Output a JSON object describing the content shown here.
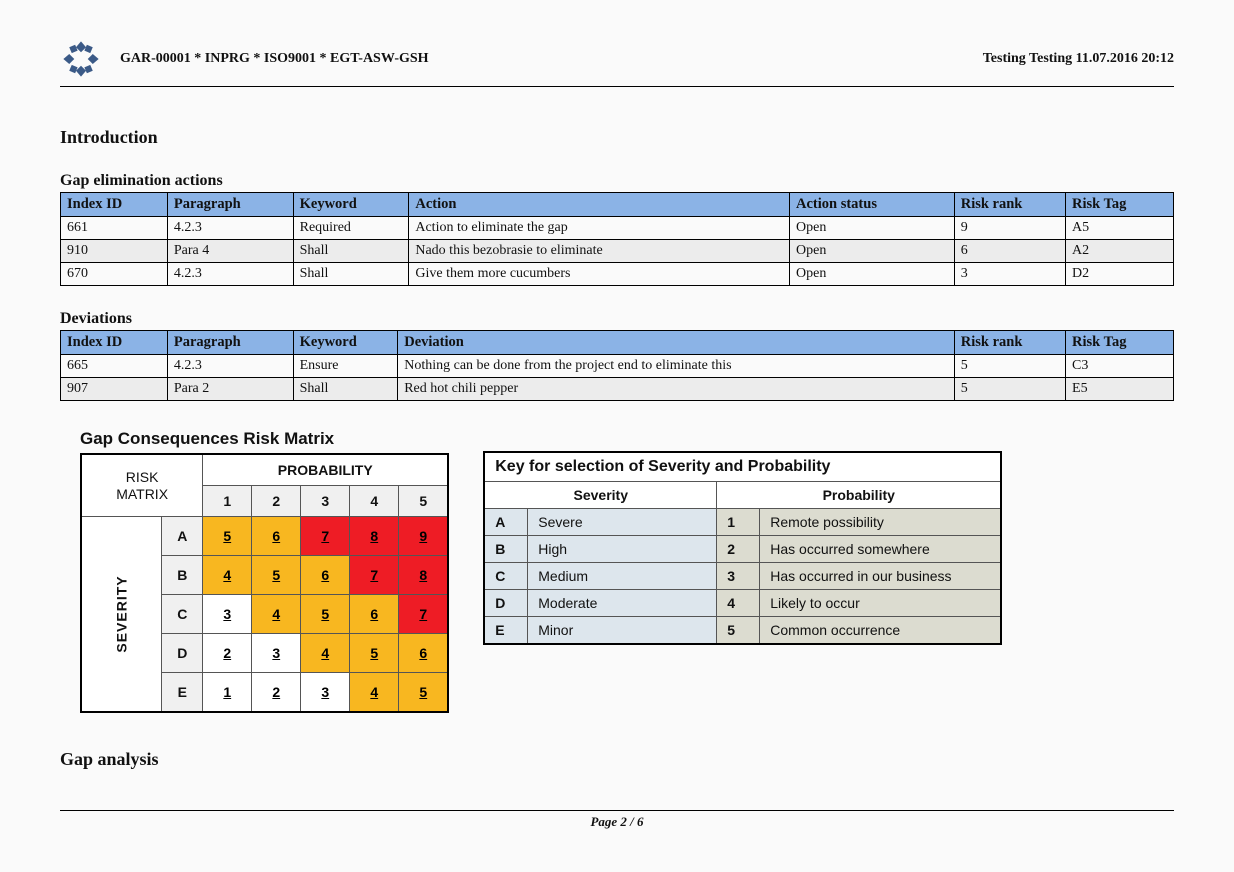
{
  "header": {
    "doc_id": "GAR-00001 * INPRG * ISO9001 * EGT-ASW-GSH",
    "stamp": "Testing Testing 11.07.2016 20:12"
  },
  "sections": {
    "intro": "Introduction",
    "gap_actions": "Gap elimination actions",
    "deviations": "Deviations",
    "gap_analysis": "Gap analysis"
  },
  "actions_table": {
    "columns": [
      "Index ID",
      "Paragraph",
      "Keyword",
      "Action",
      "Action status",
      "Risk rank",
      "Risk Tag"
    ],
    "rows": [
      [
        "661",
        "4.2.3",
        "Required",
        "Action to eliminate the gap",
        "Open",
        "9",
        "A5"
      ],
      [
        "910",
        "Para 4",
        "Shall",
        "Nado this bezobrasie to eliminate",
        "Open",
        "6",
        "A2"
      ],
      [
        "670",
        "4.2.3",
        "Shall",
        "Give them more cucumbers",
        "Open",
        "3",
        "D2"
      ]
    ]
  },
  "deviations_table": {
    "columns": [
      "Index ID",
      "Paragraph",
      "Keyword",
      "Deviation",
      "Risk rank",
      "Risk Tag"
    ],
    "rows": [
      [
        "665",
        "4.2.3",
        "Ensure",
        "Nothing can be done from the project end to eliminate this",
        "5",
        "C3"
      ],
      [
        "907",
        "Para 2",
        "Shall",
        "Red hot chili pepper",
        "5",
        "E5"
      ]
    ]
  },
  "risk_matrix": {
    "title": "Gap Consequences Risk Matrix",
    "corner_top": "RISK",
    "corner_bot": "MATRIX",
    "prob_label": "PROBABILITY",
    "sev_label": "SEVERITY",
    "prob_levels": [
      "1",
      "2",
      "3",
      "4",
      "5"
    ],
    "sev_levels": [
      "A",
      "B",
      "C",
      "D",
      "E"
    ],
    "cells": [
      [
        {
          "v": "5",
          "c": "orange"
        },
        {
          "v": "6",
          "c": "orange"
        },
        {
          "v": "7",
          "c": "red"
        },
        {
          "v": "8",
          "c": "red"
        },
        {
          "v": "9",
          "c": "red"
        }
      ],
      [
        {
          "v": "4",
          "c": "orange"
        },
        {
          "v": "5",
          "c": "orange"
        },
        {
          "v": "6",
          "c": "orange"
        },
        {
          "v": "7",
          "c": "red"
        },
        {
          "v": "8",
          "c": "red"
        }
      ],
      [
        {
          "v": "3",
          "c": "white"
        },
        {
          "v": "4",
          "c": "orange"
        },
        {
          "v": "5",
          "c": "orange"
        },
        {
          "v": "6",
          "c": "orange"
        },
        {
          "v": "7",
          "c": "red"
        }
      ],
      [
        {
          "v": "2",
          "c": "white"
        },
        {
          "v": "3",
          "c": "white"
        },
        {
          "v": "4",
          "c": "orange"
        },
        {
          "v": "5",
          "c": "orange"
        },
        {
          "v": "6",
          "c": "orange"
        }
      ],
      [
        {
          "v": "1",
          "c": "white"
        },
        {
          "v": "2",
          "c": "white"
        },
        {
          "v": "3",
          "c": "white"
        },
        {
          "v": "4",
          "c": "orange"
        },
        {
          "v": "5",
          "c": "orange"
        }
      ]
    ]
  },
  "key_table": {
    "title": "Key for selection of Severity and Probability",
    "sev_hd": "Severity",
    "prob_hd": "Probability",
    "rows": [
      {
        "l": "A",
        "sev": "Severe",
        "n": "1",
        "prob": "Remote possibility"
      },
      {
        "l": "B",
        "sev": "High",
        "n": "2",
        "prob": "Has occurred somewhere"
      },
      {
        "l": "C",
        "sev": "Medium",
        "n": "3",
        "prob": "Has occurred in our business"
      },
      {
        "l": "D",
        "sev": "Moderate",
        "n": "4",
        "prob": "Likely to occur"
      },
      {
        "l": "E",
        "sev": "Minor",
        "n": "5",
        "prob": "Common occurrence"
      }
    ]
  },
  "footer": "Page 2 / 6"
}
